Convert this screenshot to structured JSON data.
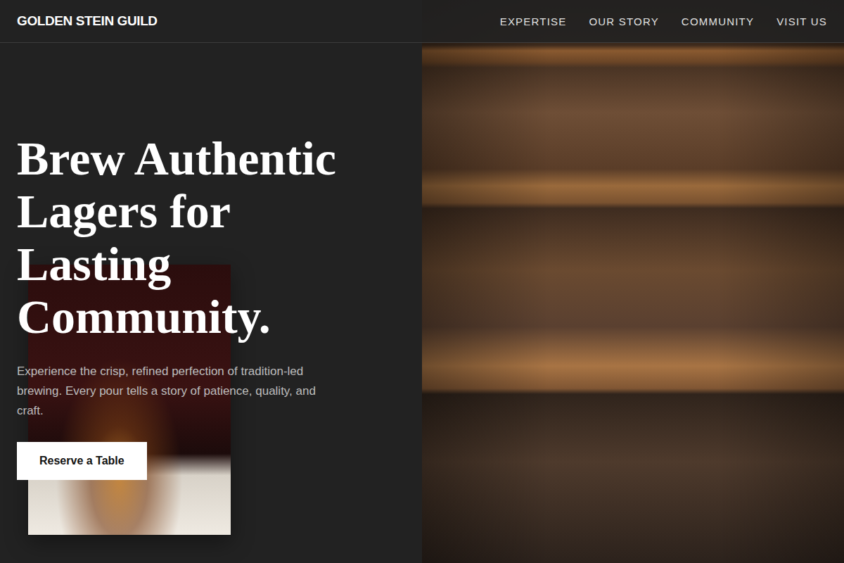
{
  "header": {
    "brand": "GOLDEN STEIN GUILD",
    "nav": [
      {
        "label": "EXPERTISE"
      },
      {
        "label": "OUR STORY"
      },
      {
        "label": "COMMUNITY"
      },
      {
        "label": "VISIT US"
      }
    ]
  },
  "hero": {
    "headline": "Brew Authentic Lagers for Lasting Community.",
    "paragraph": "Experience the crisp, refined perfection of tradition-led brewing. Every pour tells a story of patience, quality, and craft.",
    "button": "Reserve a Table"
  }
}
